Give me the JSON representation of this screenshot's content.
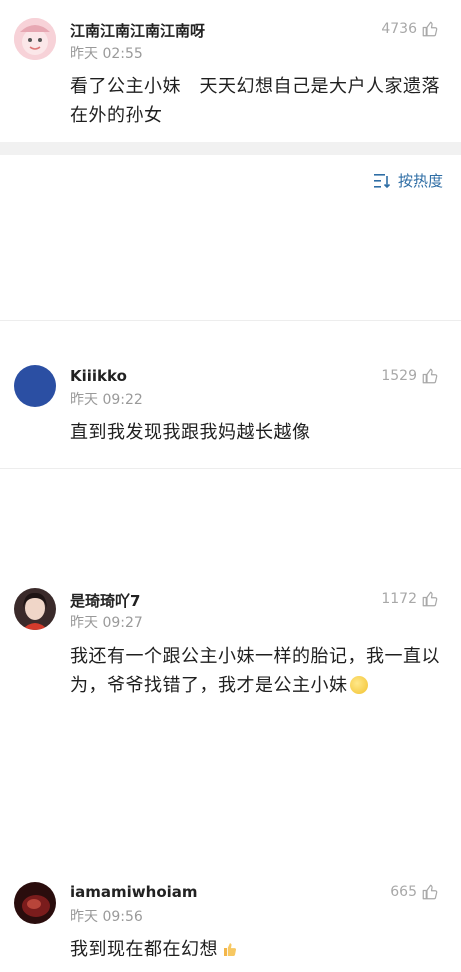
{
  "top_comment": {
    "username": "江南江南江南江南呀",
    "time": "昨天 02:55",
    "likes": "4736",
    "text": "看了公主小妹　天天幻想自己是大户人家遗落在外的孙女"
  },
  "sort": {
    "label": "按热度",
    "icon": "sort-icon"
  },
  "comments": [
    {
      "username": "Kiiikko",
      "time": "昨天 09:22",
      "likes": "1529",
      "text": "直到我发现我跟我妈越长越像"
    },
    {
      "username": "是琦琦吖7",
      "time": "昨天 09:27",
      "likes": "1172",
      "text": "我还有一个跟公主小妹一样的胎记，我一直以为，爷爷找错了，我才是公主小妹",
      "trailing_emoji": "sleepy-face"
    },
    {
      "username": "iamamiwhoiam",
      "time": "昨天 09:56",
      "likes": "665",
      "text": "我到现在都在幻想",
      "trailing_emoji": "thumbs-up"
    }
  ],
  "colors": {
    "link_blue": "#2f6ea5",
    "meta_gray": "#9a9a9a",
    "divider_gray": "#f1f1f1"
  }
}
